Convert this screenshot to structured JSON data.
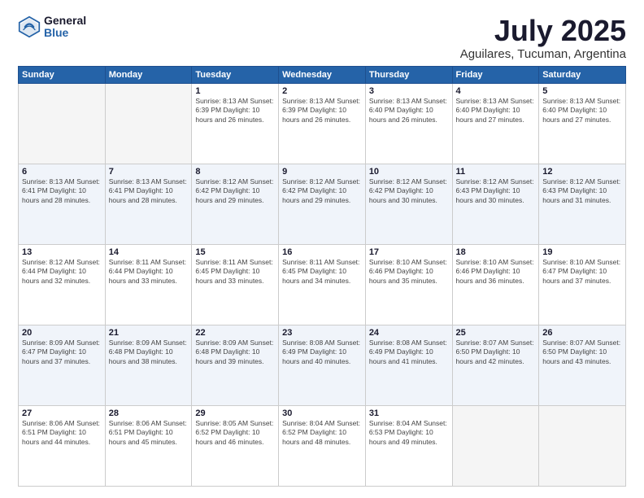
{
  "logo": {
    "general": "General",
    "blue": "Blue"
  },
  "title": "July 2025",
  "subtitle": "Aguilares, Tucuman, Argentina",
  "days_of_week": [
    "Sunday",
    "Monday",
    "Tuesday",
    "Wednesday",
    "Thursday",
    "Friday",
    "Saturday"
  ],
  "weeks": [
    [
      {
        "num": "",
        "info": ""
      },
      {
        "num": "",
        "info": ""
      },
      {
        "num": "1",
        "info": "Sunrise: 8:13 AM\nSunset: 6:39 PM\nDaylight: 10 hours\nand 26 minutes."
      },
      {
        "num": "2",
        "info": "Sunrise: 8:13 AM\nSunset: 6:39 PM\nDaylight: 10 hours\nand 26 minutes."
      },
      {
        "num": "3",
        "info": "Sunrise: 8:13 AM\nSunset: 6:40 PM\nDaylight: 10 hours\nand 26 minutes."
      },
      {
        "num": "4",
        "info": "Sunrise: 8:13 AM\nSunset: 6:40 PM\nDaylight: 10 hours\nand 27 minutes."
      },
      {
        "num": "5",
        "info": "Sunrise: 8:13 AM\nSunset: 6:40 PM\nDaylight: 10 hours\nand 27 minutes."
      }
    ],
    [
      {
        "num": "6",
        "info": "Sunrise: 8:13 AM\nSunset: 6:41 PM\nDaylight: 10 hours\nand 28 minutes."
      },
      {
        "num": "7",
        "info": "Sunrise: 8:13 AM\nSunset: 6:41 PM\nDaylight: 10 hours\nand 28 minutes."
      },
      {
        "num": "8",
        "info": "Sunrise: 8:12 AM\nSunset: 6:42 PM\nDaylight: 10 hours\nand 29 minutes."
      },
      {
        "num": "9",
        "info": "Sunrise: 8:12 AM\nSunset: 6:42 PM\nDaylight: 10 hours\nand 29 minutes."
      },
      {
        "num": "10",
        "info": "Sunrise: 8:12 AM\nSunset: 6:42 PM\nDaylight: 10 hours\nand 30 minutes."
      },
      {
        "num": "11",
        "info": "Sunrise: 8:12 AM\nSunset: 6:43 PM\nDaylight: 10 hours\nand 30 minutes."
      },
      {
        "num": "12",
        "info": "Sunrise: 8:12 AM\nSunset: 6:43 PM\nDaylight: 10 hours\nand 31 minutes."
      }
    ],
    [
      {
        "num": "13",
        "info": "Sunrise: 8:12 AM\nSunset: 6:44 PM\nDaylight: 10 hours\nand 32 minutes."
      },
      {
        "num": "14",
        "info": "Sunrise: 8:11 AM\nSunset: 6:44 PM\nDaylight: 10 hours\nand 33 minutes."
      },
      {
        "num": "15",
        "info": "Sunrise: 8:11 AM\nSunset: 6:45 PM\nDaylight: 10 hours\nand 33 minutes."
      },
      {
        "num": "16",
        "info": "Sunrise: 8:11 AM\nSunset: 6:45 PM\nDaylight: 10 hours\nand 34 minutes."
      },
      {
        "num": "17",
        "info": "Sunrise: 8:10 AM\nSunset: 6:46 PM\nDaylight: 10 hours\nand 35 minutes."
      },
      {
        "num": "18",
        "info": "Sunrise: 8:10 AM\nSunset: 6:46 PM\nDaylight: 10 hours\nand 36 minutes."
      },
      {
        "num": "19",
        "info": "Sunrise: 8:10 AM\nSunset: 6:47 PM\nDaylight: 10 hours\nand 37 minutes."
      }
    ],
    [
      {
        "num": "20",
        "info": "Sunrise: 8:09 AM\nSunset: 6:47 PM\nDaylight: 10 hours\nand 37 minutes."
      },
      {
        "num": "21",
        "info": "Sunrise: 8:09 AM\nSunset: 6:48 PM\nDaylight: 10 hours\nand 38 minutes."
      },
      {
        "num": "22",
        "info": "Sunrise: 8:09 AM\nSunset: 6:48 PM\nDaylight: 10 hours\nand 39 minutes."
      },
      {
        "num": "23",
        "info": "Sunrise: 8:08 AM\nSunset: 6:49 PM\nDaylight: 10 hours\nand 40 minutes."
      },
      {
        "num": "24",
        "info": "Sunrise: 8:08 AM\nSunset: 6:49 PM\nDaylight: 10 hours\nand 41 minutes."
      },
      {
        "num": "25",
        "info": "Sunrise: 8:07 AM\nSunset: 6:50 PM\nDaylight: 10 hours\nand 42 minutes."
      },
      {
        "num": "26",
        "info": "Sunrise: 8:07 AM\nSunset: 6:50 PM\nDaylight: 10 hours\nand 43 minutes."
      }
    ],
    [
      {
        "num": "27",
        "info": "Sunrise: 8:06 AM\nSunset: 6:51 PM\nDaylight: 10 hours\nand 44 minutes."
      },
      {
        "num": "28",
        "info": "Sunrise: 8:06 AM\nSunset: 6:51 PM\nDaylight: 10 hours\nand 45 minutes."
      },
      {
        "num": "29",
        "info": "Sunrise: 8:05 AM\nSunset: 6:52 PM\nDaylight: 10 hours\nand 46 minutes."
      },
      {
        "num": "30",
        "info": "Sunrise: 8:04 AM\nSunset: 6:52 PM\nDaylight: 10 hours\nand 48 minutes."
      },
      {
        "num": "31",
        "info": "Sunrise: 8:04 AM\nSunset: 6:53 PM\nDaylight: 10 hours\nand 49 minutes."
      },
      {
        "num": "",
        "info": ""
      },
      {
        "num": "",
        "info": ""
      }
    ]
  ]
}
